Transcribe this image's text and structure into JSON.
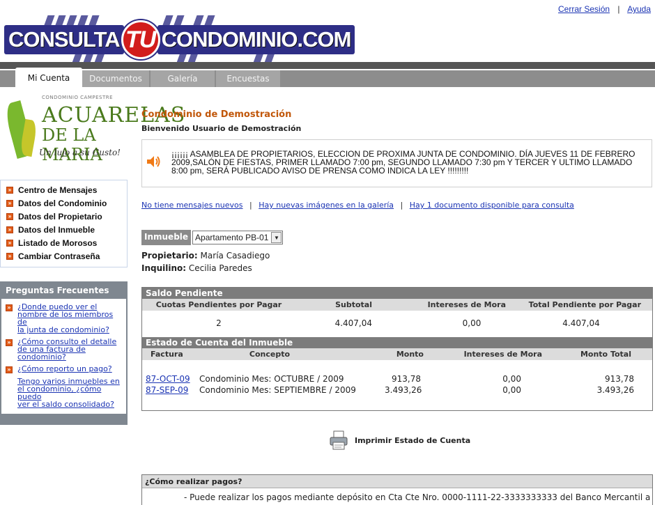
{
  "header": {
    "logout": "Cerrar Sesión",
    "separator": "|",
    "help": "Ayuda",
    "logo": {
      "part1": "CONSULTA",
      "part2": "TU",
      "part3": "CONDOMINIO.COM"
    }
  },
  "tabs": [
    {
      "label": "Mi Cuenta",
      "active": true
    },
    {
      "label": "Documentos",
      "active": false
    },
    {
      "label": "Galería",
      "active": false
    },
    {
      "label": "Encuestas",
      "active": false
    }
  ],
  "brand": {
    "top": "CONDOMINIO CAMPESTRE",
    "name1": "ACUARELAS",
    "name2": "DE LA MARIA",
    "tagline": "Un lujo a su Gusto!"
  },
  "menu": [
    "Centro de Mensajes",
    "Datos del Condominio",
    "Datos del Propietario",
    "Datos del Inmueble",
    "Listado de Morosos",
    "Cambiar Contraseña"
  ],
  "faq": {
    "title": "Preguntas Frecuentes",
    "items": [
      [
        "¿Donde puedo ver el",
        "nombre de los miembros de",
        "la junta de condominio?"
      ],
      [
        "¿Cómo consulto el detalle",
        "de una factura de",
        "condominio?"
      ],
      [
        "¿Cómo reporto un pago?"
      ],
      [
        "Tengo varios inmuebles en",
        "el condominio, ¿cómo puedo",
        "ver el saldo consolidado?"
      ]
    ]
  },
  "main": {
    "title": "Condominio de Demostración",
    "welcome": "Bienvenido Usuario de Demostración",
    "announcement": [
      "¡¡¡¡¡¡ ASAMBLEA DE PROPIETARIOS, ELECCION DE PROXIMA JUNTA DE CONDOMINIO. DÍA JUEVES 11 DE FEBRERO",
      "2009,SALÓN DE FIESTAS, PRIMER LLAMADO 7:00 pm, SEGUNDO LLAMADO 7:30 pm Y TERCER Y ULTIMO LLAMADO",
      "8:00 pm, SERÁ PUBLICADO AVISO DE PRENSA COMO INDICA LA LEY !!!!!!!!!"
    ],
    "notices": {
      "messages": "No tiene mensajes nuevos",
      "gallery": "Hay nuevas imágenes en la galería",
      "documents": " Hay 1 documento disponible para consulta",
      "separator": "|"
    },
    "property": {
      "label": "Inmueble",
      "selected": "Apartamento PB-01",
      "arrow": "▼"
    },
    "owner": {
      "label": "Propietario:",
      "value": "María Casadiego"
    },
    "tenant": {
      "label": "Inquilino:",
      "value": "Cecilia Paredes"
    }
  },
  "saldo": {
    "title": "Saldo Pendiente",
    "columns": [
      "Cuotas Pendientes por Pagar",
      "Subtotal",
      "Intereses de Mora",
      "Total Pendiente por Pagar"
    ],
    "row": [
      "2",
      "4.407,04",
      "0,00",
      "4.407,04"
    ]
  },
  "estado": {
    "title": "Estado de Cuenta del Inmueble",
    "columns": [
      "Factura",
      "Concepto",
      "Monto",
      "Intereses de Mora",
      "Monto Total"
    ],
    "rows": [
      [
        "87-OCT-09",
        "Condominio Mes: OCTUBRE / 2009",
        "913,78",
        "0,00",
        "913,78"
      ],
      [
        "87-SEP-09",
        "Condominio Mes: SEPTIEMBRE / 2009",
        "3.493,26",
        "0,00",
        "3.493,26"
      ]
    ]
  },
  "print": {
    "label": "Imprimir Estado de Cuenta"
  },
  "pagos": {
    "title": "¿Cómo realizar pagos?",
    "text": "- Puede realizar los pagos mediante depósito en Cta Cte Nro. 0000-1111-22-3333333333 del Banco Mercantil a"
  }
}
